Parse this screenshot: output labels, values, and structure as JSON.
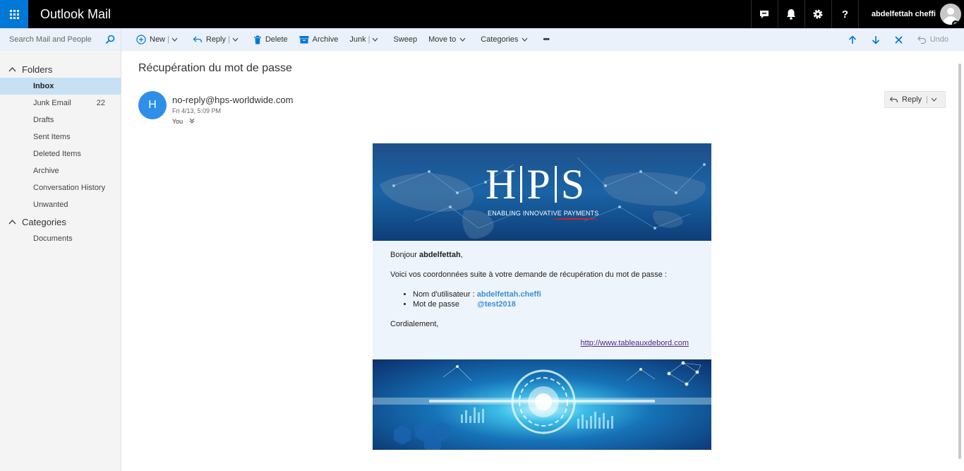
{
  "app": {
    "title": "Outlook Mail"
  },
  "user": {
    "name": "abdelfettah cheffi"
  },
  "search": {
    "placeholder": "Search Mail and People"
  },
  "folders": {
    "header": "Folders",
    "items": [
      {
        "label": "Inbox",
        "count": ""
      },
      {
        "label": "Junk Email",
        "count": "22"
      },
      {
        "label": "Drafts",
        "count": ""
      },
      {
        "label": "Sent Items",
        "count": ""
      },
      {
        "label": "Deleted Items",
        "count": ""
      },
      {
        "label": "Archive",
        "count": ""
      },
      {
        "label": "Conversation History",
        "count": ""
      },
      {
        "label": "Unwanted",
        "count": ""
      }
    ]
  },
  "categories": {
    "header": "Categories",
    "items": [
      {
        "label": "Documents"
      }
    ]
  },
  "toolbar": {
    "new": "New",
    "reply": "Reply",
    "delete": "Delete",
    "archive": "Archive",
    "junk": "Junk",
    "sweep": "Sweep",
    "move_to": "Move to",
    "categories": "Categories",
    "more": "•••",
    "undo": "Undo"
  },
  "message": {
    "subject": "Récupération du mot de passe",
    "avatar_letter": "H",
    "sender": "no-reply@hps-worldwide.com",
    "date": "Fri 4/13, 5:09 PM",
    "to": "You",
    "reply_label": "Reply"
  },
  "email": {
    "logo": {
      "letters": [
        "H",
        "P",
        "S"
      ],
      "tagline": "ENABLING INNOVATIVE PAYMENTS"
    },
    "greeting_prefix": "Bonjour ",
    "greeting_name": "abdelfettah",
    "greeting_suffix": ",",
    "intro": "Voici vos coordonnées suite à votre demande de récupération du mot de passe :",
    "username_label": "Nom d'utilisateur : ",
    "username_value": "abdelfettah.cheffi",
    "password_label": "Mot de passe ",
    "password_value": "@test2018",
    "closing": "Cordialement,",
    "link": "http://www.tableauxdebord.com"
  },
  "colors": {
    "brand": "#0078d7",
    "command_bar": "#eaf1fa",
    "active_folder": "#c7e0f4",
    "avatar": "#2f8ee8",
    "value_blue": "#3b8fd8"
  }
}
